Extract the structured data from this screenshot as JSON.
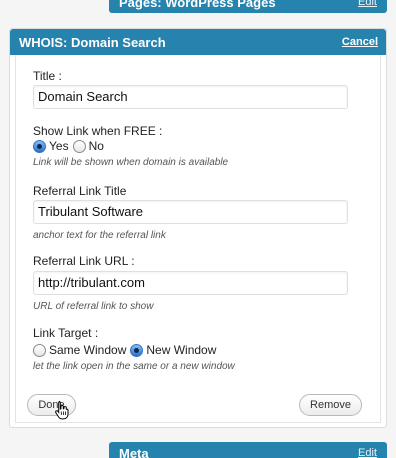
{
  "top_widget": {
    "title": "Pages: WordPress Pages",
    "edit_label": "Edit"
  },
  "bottom_widget": {
    "title": "Meta",
    "edit_label": "Edit"
  },
  "panel": {
    "title": "WHOIS: Domain Search",
    "cancel_label": "Cancel"
  },
  "fields": {
    "title": {
      "label": "Title :",
      "value": "Domain Search"
    },
    "show_link": {
      "label": "Show Link when FREE :",
      "options": [
        "Yes",
        "No"
      ],
      "selected": "Yes",
      "hint": "Link will be shown when domain is available"
    },
    "ref_title": {
      "label": "Referral Link Title",
      "value": "Tribulant Software",
      "hint": "anchor text for the referral link"
    },
    "ref_url": {
      "label": "Referral Link URL :",
      "value": "http://tribulant.com",
      "hint": "URL of referral link to show"
    },
    "link_target": {
      "label": "Link Target :",
      "options": [
        "Same Window",
        "New Window"
      ],
      "selected": "New Window",
      "hint": "let the link open in the same or a new window"
    }
  },
  "buttons": {
    "done": "Done",
    "remove": "Remove"
  },
  "colors": {
    "header": "#2683ae",
    "radio_selected": "#2e6fc8"
  }
}
